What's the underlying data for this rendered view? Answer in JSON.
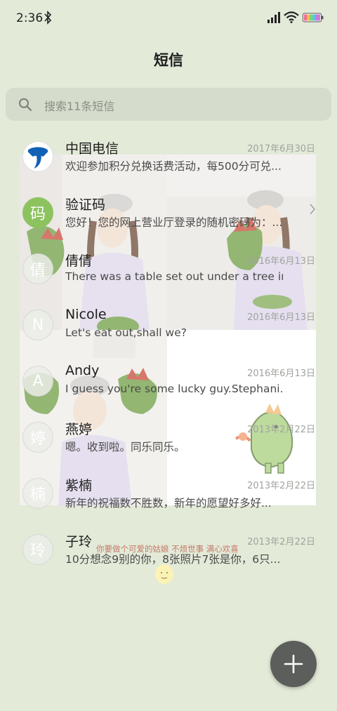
{
  "status_bar": {
    "time": "2:36"
  },
  "header": {
    "title": "短信"
  },
  "search": {
    "placeholder": "搜索11条短信"
  },
  "messages": [
    {
      "sender": "中国电信",
      "avatar": "",
      "date": "2017年6月30日",
      "preview": "欢迎参加积分兑换话费活动，每500分可兑..."
    },
    {
      "sender": "验证码",
      "avatar": "码",
      "date": "",
      "preview": "您好！您的网上营业厅登录的随机密码为：..."
    },
    {
      "sender": "倩倩",
      "avatar": "倩",
      "date": "2016年6月13日",
      "preview": "There was a table set out under a tree in..."
    },
    {
      "sender": "Nicole",
      "avatar": "N",
      "date": "2016年6月13日",
      "preview": "Let's eat out,shall we?"
    },
    {
      "sender": "Andy",
      "avatar": "A",
      "date": "2016年6月13日",
      "preview": "I guess you're some lucky guy.Stephani..."
    },
    {
      "sender": "燕婷",
      "avatar": "婷",
      "date": "2013年2月22日",
      "preview": "嗯。收到啦。同乐同乐。"
    },
    {
      "sender": "紫楠",
      "avatar": "楠",
      "date": "2013年2月22日",
      "preview": "新年的祝福数不胜数，新年的愿望好多好..."
    },
    {
      "sender": "子玲",
      "avatar": "玲",
      "date": "2013年2月22日",
      "preview": "10分想念9别的你，8张照片7张是你，6只..."
    }
  ],
  "watermark": "你要做个可爱的姑娘 不烦世事 满心欢喜",
  "icons": {
    "bluetooth": "bluetooth-icon",
    "signal": "signal-icon",
    "wifi": "wifi-icon",
    "battery": "battery-icon",
    "search": "search-icon",
    "chevron": "chevron-right-icon",
    "compose": "plus-icon"
  },
  "colors": {
    "background": "#e3ead8",
    "search_bg": "#d5dccb",
    "avatar_green": "#8cc35f",
    "fab": "#5c5e5b"
  }
}
